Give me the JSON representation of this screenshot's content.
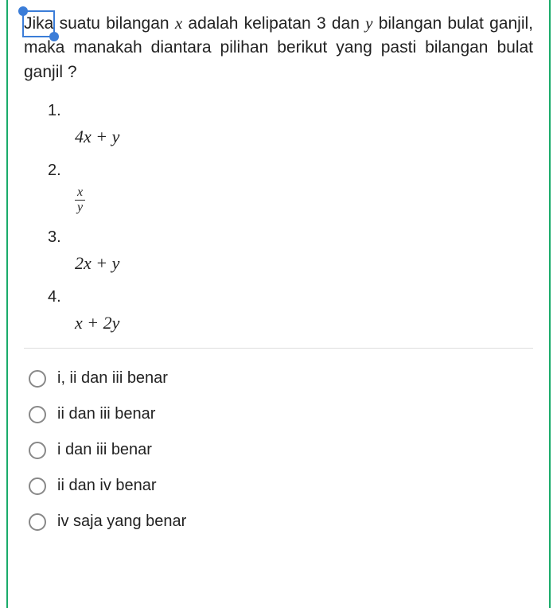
{
  "question": {
    "part1_highlighted": "Jika",
    "part2": " suatu bilangan ",
    "var_x": "x",
    "part3": " adalah kelipatan 3 dan ",
    "var_y": "y",
    "part4": " bilangan bulat ganjil, maka manakah diantara pilihan berikut yang pasti bilangan bulat ganjil ?"
  },
  "stems": [
    {
      "num": "1.",
      "expr": "4x + y",
      "type": "plain"
    },
    {
      "num": "2.",
      "expr_num": "x",
      "expr_den": "y",
      "type": "frac"
    },
    {
      "num": "3.",
      "expr": "2x + y",
      "type": "plain"
    },
    {
      "num": "4.",
      "expr": "x + 2y",
      "type": "plain"
    }
  ],
  "choices": [
    {
      "label": "i, ii dan iii benar"
    },
    {
      "label": "ii dan iii benar"
    },
    {
      "label": "i dan iii benar"
    },
    {
      "label": "ii dan iv benar"
    },
    {
      "label": "iv saja yang benar"
    }
  ]
}
